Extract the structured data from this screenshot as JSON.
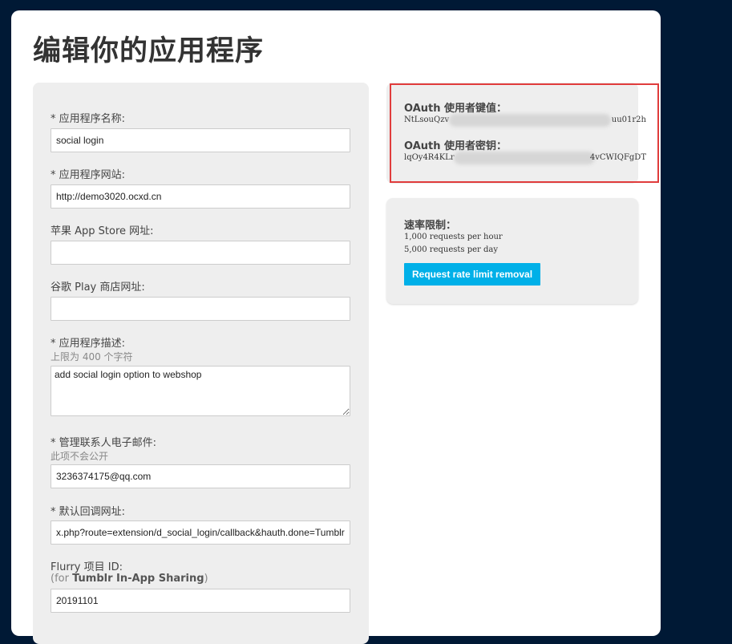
{
  "page": {
    "title": "编辑你的应用程序"
  },
  "form": {
    "app_name": {
      "label": "* 应用程序名称:",
      "value": "social login"
    },
    "app_website": {
      "label": "* 应用程序网站:",
      "value": "http://demo3020.ocxd.cn"
    },
    "apple_store_url": {
      "label": "苹果 App Store 网址:",
      "value": ""
    },
    "google_play_url": {
      "label": "谷歌 Play 商店网址:",
      "value": ""
    },
    "app_description": {
      "label": "* 应用程序描述:",
      "hint": "上限为 400 个字符",
      "value": "add social login option to webshop"
    },
    "admin_email": {
      "label": "* 管理联系人电子邮件:",
      "hint": "此项不会公开",
      "value": "3236374175@qq.com"
    },
    "callback_url": {
      "label": "* 默认回调网址:",
      "value": "x.php?route=extension/d_social_login/callback&hauth.done=Tumblr"
    },
    "flurry_id": {
      "label": "Flurry 项目 ID:",
      "hint_prefix": "(for ",
      "hint_bold": "Tumblr In-App Sharing",
      "hint_suffix": ")",
      "value": "20191101"
    }
  },
  "oauth": {
    "consumer_key_title": "OAuth 使用者键值：",
    "consumer_key_start": "NtLsouQzv",
    "consumer_key_end": "uu01r2h",
    "consumer_secret_title": "OAuth 使用者密钥：",
    "consumer_secret_start": "lqOy4R4KLr",
    "consumer_secret_end": "4vCWIQFgDT"
  },
  "rate_limit": {
    "title": "速率限制：",
    "per_hour": "1,000 requests per hour",
    "per_day": "5,000 requests per day",
    "button_label": "Request rate limit removal"
  },
  "colors": {
    "background": "#001935",
    "panel": "#eeeeee",
    "highlight": "#e03c3c",
    "button": "#00b0e8"
  }
}
